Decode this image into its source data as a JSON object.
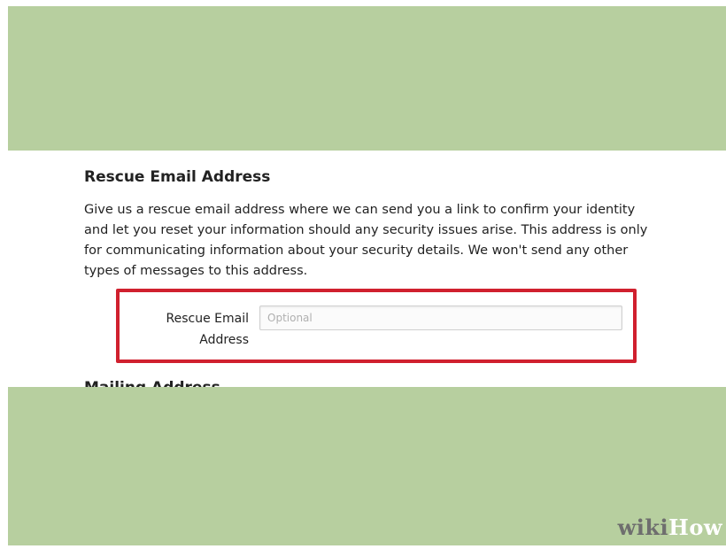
{
  "section": {
    "title": "Rescue Email Address",
    "description": "Give us a rescue email address where we can send you a link to confirm your identity and let you reset your information should any security issues arise. This address is only for communicating information about your security details. We won't send any other types of messages to this address."
  },
  "form": {
    "rescue_email": {
      "label_line1": "Rescue Email",
      "label_line2": "Address",
      "value": "",
      "placeholder": "Optional"
    }
  },
  "next_section": {
    "title": "Mailing Address"
  },
  "watermark": {
    "part1": "wiki",
    "part2": "How"
  },
  "colors": {
    "background_band": "#b7cf9f",
    "highlight_border": "#d0202e"
  }
}
